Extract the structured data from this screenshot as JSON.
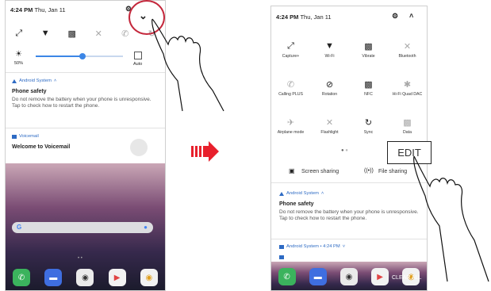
{
  "left": {
    "status_time": "4:24 PM",
    "status_date": "Thu, Jan 11",
    "quick_icons": [
      "expand-icon",
      "wifi-icon",
      "vibrate-icon",
      "bluetooth-icon",
      "calling-plus-icon",
      "rotation-icon"
    ],
    "brightness_label": "50%",
    "auto_label": "Auto",
    "notif1_app": "Android System",
    "notif1_title": "Phone safety",
    "notif1_body": "Do not remove the battery when your phone is unresponsive. Tap to check how to restart the phone.",
    "notif2_app": "Voicemail",
    "notif2_title": "Welcome to Voicemail"
  },
  "right": {
    "status_time": "4:24 PM",
    "status_date": "Thu, Jan 11",
    "tiles": [
      {
        "label": "Capture+",
        "icon": "capture-icon"
      },
      {
        "label": "Wi-Fi",
        "icon": "wifi-icon"
      },
      {
        "label": "Vibrate",
        "icon": "vibrate-icon"
      },
      {
        "label": "Bluetooth",
        "icon": "bluetooth-icon"
      },
      {
        "label": "Calling PLUS",
        "icon": "calling-plus-icon"
      },
      {
        "label": "Rotation",
        "icon": "rotation-icon"
      },
      {
        "label": "NFC",
        "icon": "nfc-icon"
      },
      {
        "label": "Hi-Fi Quad DAC",
        "icon": "dac-icon"
      },
      {
        "label": "Airplane mode",
        "icon": "airplane-icon"
      },
      {
        "label": "Flashlight",
        "icon": "flashlight-icon"
      },
      {
        "label": "Sync",
        "icon": "sync-icon"
      },
      {
        "label": "Data",
        "icon": "data-icon"
      }
    ],
    "edit_label": "EDIT",
    "screen_sharing": "Screen sharing",
    "file_sharing": "File sharing",
    "notif1_app": "Android System",
    "notif1_title": "Phone safety",
    "notif1_body": "Do not remove the battery when your phone is unresponsive. Tap to check how to restart the phone.",
    "notif2_app": "Android System • 4:24 PM",
    "clear_all": "CLEAR ALL"
  }
}
